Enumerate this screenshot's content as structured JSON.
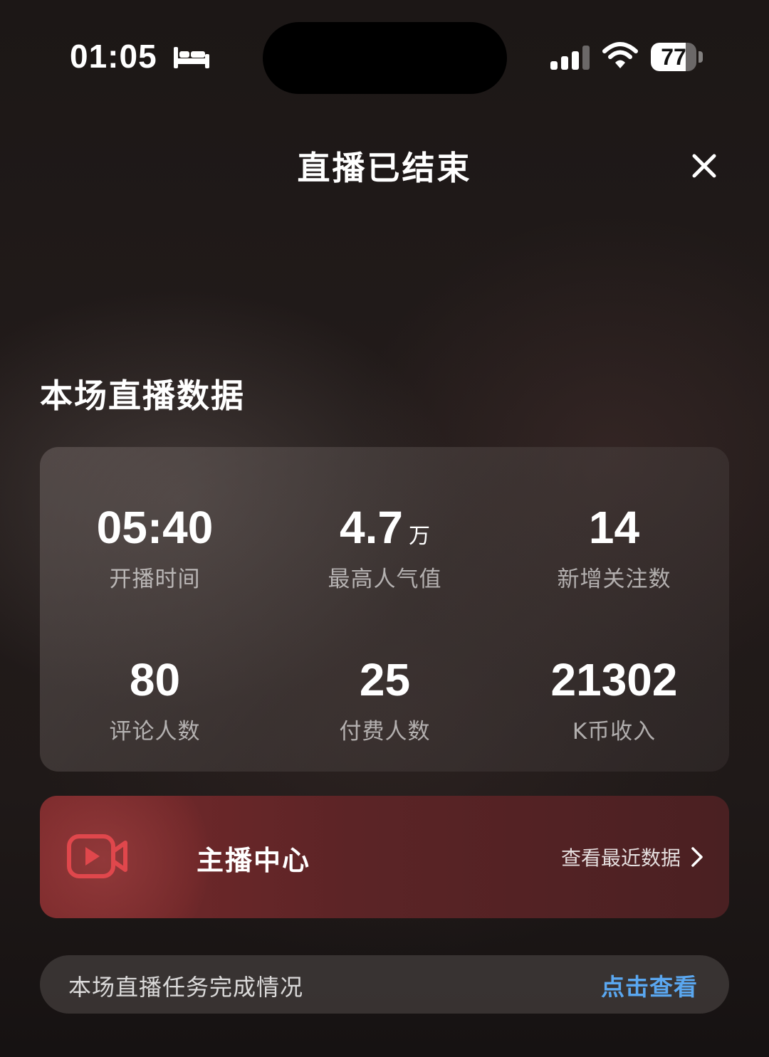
{
  "status_bar": {
    "time": "01:05",
    "battery_level": "77",
    "battery_fraction": 0.77,
    "icons": [
      "sleep-icon",
      "signal-icon",
      "wifi-icon",
      "battery-icon"
    ]
  },
  "header": {
    "title": "直播已结束",
    "close_icon": "close-icon"
  },
  "section": {
    "title": "本场直播数据"
  },
  "stats": [
    {
      "value": "05:40",
      "unit": "",
      "label": "开播时间"
    },
    {
      "value": "4.7",
      "unit": "万",
      "label": "最高人气值"
    },
    {
      "value": "14",
      "unit": "",
      "label": "新增关注数"
    },
    {
      "value": "80",
      "unit": "",
      "label": "评论人数"
    },
    {
      "value": "25",
      "unit": "",
      "label": "付费人数"
    },
    {
      "value": "21302",
      "unit": "",
      "label": "K币收入"
    }
  ],
  "anchor_center": {
    "title": "主播中心",
    "link_label": "查看最近数据",
    "icon": "video-camera-icon",
    "accent_color": "#e0474c"
  },
  "task": {
    "label": "本场直播任务完成情况",
    "link_label": "点击查看",
    "link_color": "#5aa7f0"
  }
}
